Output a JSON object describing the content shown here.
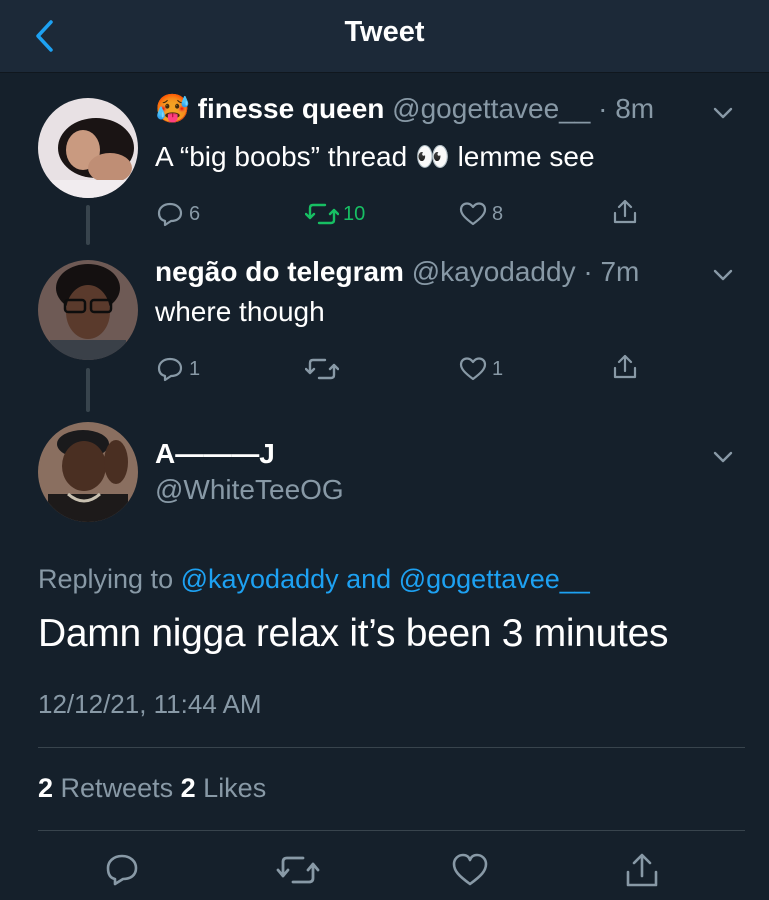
{
  "header": {
    "title": "Tweet"
  },
  "tweets": [
    {
      "emoji": "🥵",
      "name": "finesse queen",
      "handle": "@gogettavee__",
      "time": "· 8m",
      "text": "A “big boobs” thread 👀 lemme see",
      "replies": "6",
      "retweets": "10",
      "likes": "8"
    },
    {
      "name": "negão do telegram",
      "handle": "@kayodaddy",
      "time": "· 7m",
      "text": "where though",
      "replies": "1",
      "retweets": "",
      "likes": "1"
    }
  ],
  "main": {
    "name": "A———J",
    "handle": "@WhiteTeeOG",
    "replying_prefix": "Replying to",
    "replying_user1": "@kayodaddy",
    "replying_and": "and",
    "replying_user2": "@gogettavee__",
    "text": "Damn nigga relax it’s been 3 minutes",
    "timestamp": "12/12/21, 11:44 AM",
    "retweet_count": "2",
    "retweet_label": "Retweets",
    "like_count": "2",
    "like_label": "Likes"
  },
  "colors": {
    "background": "#15202b",
    "header": "#1c2938",
    "muted": "#8899a6",
    "link": "#1da1f2",
    "retweet_active": "#17bf63"
  },
  "icons": [
    "chevron-left-icon",
    "chevron-down-icon",
    "reply-icon",
    "retweet-icon",
    "heart-icon",
    "share-icon"
  ]
}
